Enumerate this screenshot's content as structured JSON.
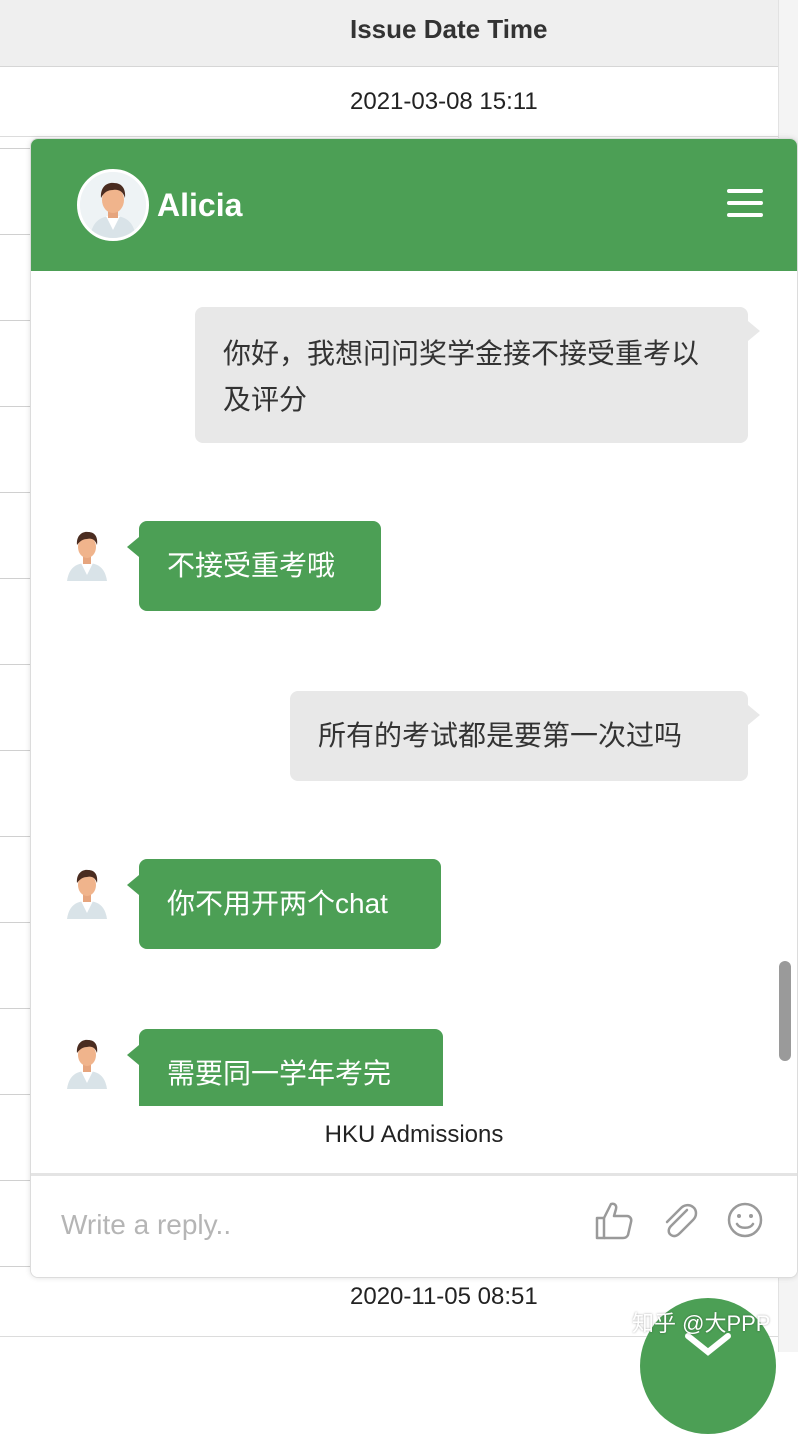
{
  "background_table": {
    "header_label": "Issue Date Time",
    "first_row_date": "2021-03-08 15:11",
    "last_row_date": "2020-11-05 08:51"
  },
  "chat": {
    "agent_name": "Alicia",
    "messages": [
      {
        "from": "user",
        "text": "你好，我想问问奖学金接不接受重考以及评分"
      },
      {
        "from": "agent",
        "text": "不接受重考哦"
      },
      {
        "from": "user",
        "text": "所有的考试都是要第一次过吗"
      },
      {
        "from": "agent",
        "text": "你不用开两个chat"
      },
      {
        "from": "agent",
        "text": "需要同一学年考完"
      }
    ],
    "powered_by": "HKU Admissions",
    "input_placeholder": "Write a reply..",
    "icons": [
      "menu-icon",
      "thumbs-up-icon",
      "attachment-icon",
      "emoji-icon",
      "close-icon"
    ],
    "accent_color": "#4c9f55",
    "user_bubble_color": "#e8e8e8"
  },
  "watermark": "知乎 @大PPP"
}
